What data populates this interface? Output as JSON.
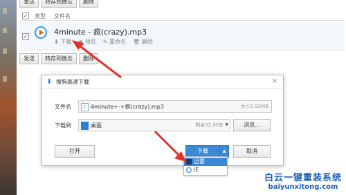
{
  "toolbar": {
    "send_label": "发送",
    "save_weiyun_label": "转存到微云",
    "delete_label": "删除"
  },
  "list_header": {
    "type_label": "类型",
    "filename_label": "文件名"
  },
  "file": {
    "name": "4minute - 疯(crazy).mp3",
    "actions": [
      "下载",
      "预览",
      "重命名",
      "删除"
    ]
  },
  "dialog": {
    "title": "搜狗高速下载",
    "filename_label": "文件名",
    "filename_value": "4minute+-+疯(crazy).mp3",
    "size_text": "大小2.92MB",
    "saveto_label": "下载到",
    "saveto_value": "桌面",
    "space_text": "剩余32.0GB",
    "browse_label": "浏览...",
    "open_label": "打开",
    "download_label": "下载",
    "cancel_label": "取消",
    "menu_items": [
      "迅雷",
      "IE"
    ]
  },
  "watermark": {
    "line1": "白云一键重装系统",
    "line2": "baiyunxitong.com"
  },
  "colors": {
    "accent": "#3b8ad8",
    "arrow": "#e0302a",
    "watermark": "#1a5fb4"
  }
}
